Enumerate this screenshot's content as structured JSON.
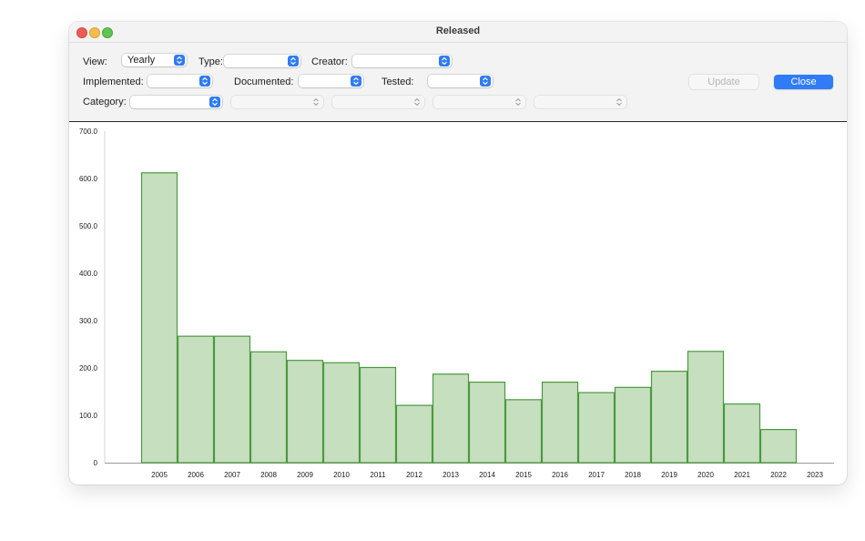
{
  "window": {
    "title": "Released"
  },
  "toolbar": {
    "view_label": "View:",
    "view_value": "Yearly",
    "type_label": "Type:",
    "type_value": "",
    "creator_label": "Creator:",
    "creator_value": "",
    "implemented_label": "Implemented:",
    "implemented_value": "",
    "documented_label": "Documented:",
    "documented_value": "",
    "tested_label": "Tested:",
    "tested_value": "",
    "category_label": "Category:",
    "category_value": "",
    "update_label": "Update",
    "close_label": "Close"
  },
  "colors": {
    "bar_fill": "#c6dfbf",
    "bar_stroke": "#4a9a3f",
    "accent": "#2f7cf6"
  },
  "chart_data": {
    "type": "bar",
    "categories": [
      "2005",
      "2006",
      "2007",
      "2008",
      "2009",
      "2010",
      "2011",
      "2012",
      "2013",
      "2014",
      "2015",
      "2016",
      "2017",
      "2018",
      "2019",
      "2020",
      "2021",
      "2022",
      "2023"
    ],
    "values": [
      612,
      267,
      267,
      234,
      216,
      211,
      201,
      121,
      187,
      170,
      133,
      170,
      148,
      159,
      193,
      235,
      124,
      70,
      0
    ],
    "yticks": [
      "0",
      "100.0",
      "200.0",
      "300.0",
      "400.0",
      "500.0",
      "600.0",
      "700.0"
    ],
    "ylim": [
      0,
      700
    ],
    "title": "",
    "xlabel": "",
    "ylabel": ""
  }
}
